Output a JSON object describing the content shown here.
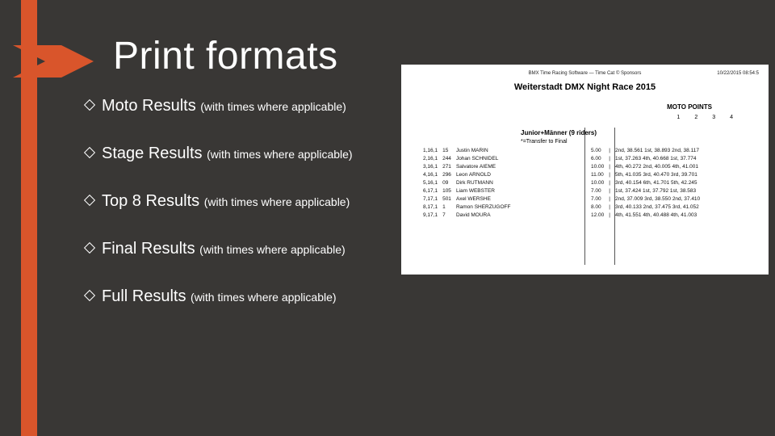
{
  "title": "Print formats",
  "bullets": [
    {
      "main": "Moto Results ",
      "sub": "(with times where applicable)"
    },
    {
      "main": "Stage Results ",
      "sub": "(with times where applicable)"
    },
    {
      "main": "Top 8 Results ",
      "sub": "(with times where applicable)"
    },
    {
      "main": "Final Results ",
      "sub": "(with times where applicable)"
    },
    {
      "main": "Full Results ",
      "sub": "(with times where applicable)"
    }
  ],
  "doc": {
    "top_center": "BMX Time Racing Software — Time Cat © Sponsors",
    "top_right": "10/22/2015 08:54:5",
    "event_title": "Weiterstadt DMX Night Race 2015",
    "section_label": "MOTO POINTS",
    "col_heads": "1234",
    "class_name": "Junior+Männer (9 riders)",
    "transfer": "*=Transfer to Final",
    "rows": [
      {
        "rk": "1,16,1",
        "no": "15",
        "name": "Justin MARIN",
        "pts": "5.00",
        "motos": "2nd, 38.561  1st, 38.893  2nd, 38.117"
      },
      {
        "rk": "2,16,1",
        "no": "244",
        "name": "Johan SCHNIDEL",
        "pts": "6.00",
        "motos": "1st, 37.263  4th, 40.668  1st, 37.774"
      },
      {
        "rk": "3,16,1",
        "no": "271",
        "name": "Salvatore AIEME",
        "pts": "10.00",
        "motos": "4th, 40.272  2nd, 40.005  4th, 41.001"
      },
      {
        "rk": "4,16,1",
        "no": "296",
        "name": "Leon ARNOLD",
        "pts": "11.00",
        "motos": "5th, 41.035  3rd, 40.470  3rd, 39.701"
      },
      {
        "rk": "5,16,1",
        "no": "09",
        "name": "Dirk RUTMANN",
        "pts": "10.00",
        "motos": "3rd, 40.154  6th, 41.701  5th, 42.245"
      },
      {
        "rk": "6,17,1",
        "no": "105",
        "name": "Liam WEBSTER",
        "pts": "7.00",
        "motos": "1st, 37.424  1st, 37.792  1st, 38.583"
      },
      {
        "rk": "7,17,1",
        "no": "501",
        "name": "Axel WERSHE",
        "pts": "7.00",
        "motos": "2nd, 37.009  3rd, 38.550  2nd, 37.410"
      },
      {
        "rk": "8,17,1",
        "no": "1",
        "name": "Ramon SHERZUGOFF",
        "pts": "8.00",
        "motos": "3rd, 40.133  2nd, 37.475  3rd, 41.052"
      },
      {
        "rk": "9,17,1",
        "no": "7",
        "name": "David MOURA",
        "pts": "12.00",
        "motos": "4th, 41.551  4th, 40.488  4th, 41.003"
      }
    ]
  }
}
